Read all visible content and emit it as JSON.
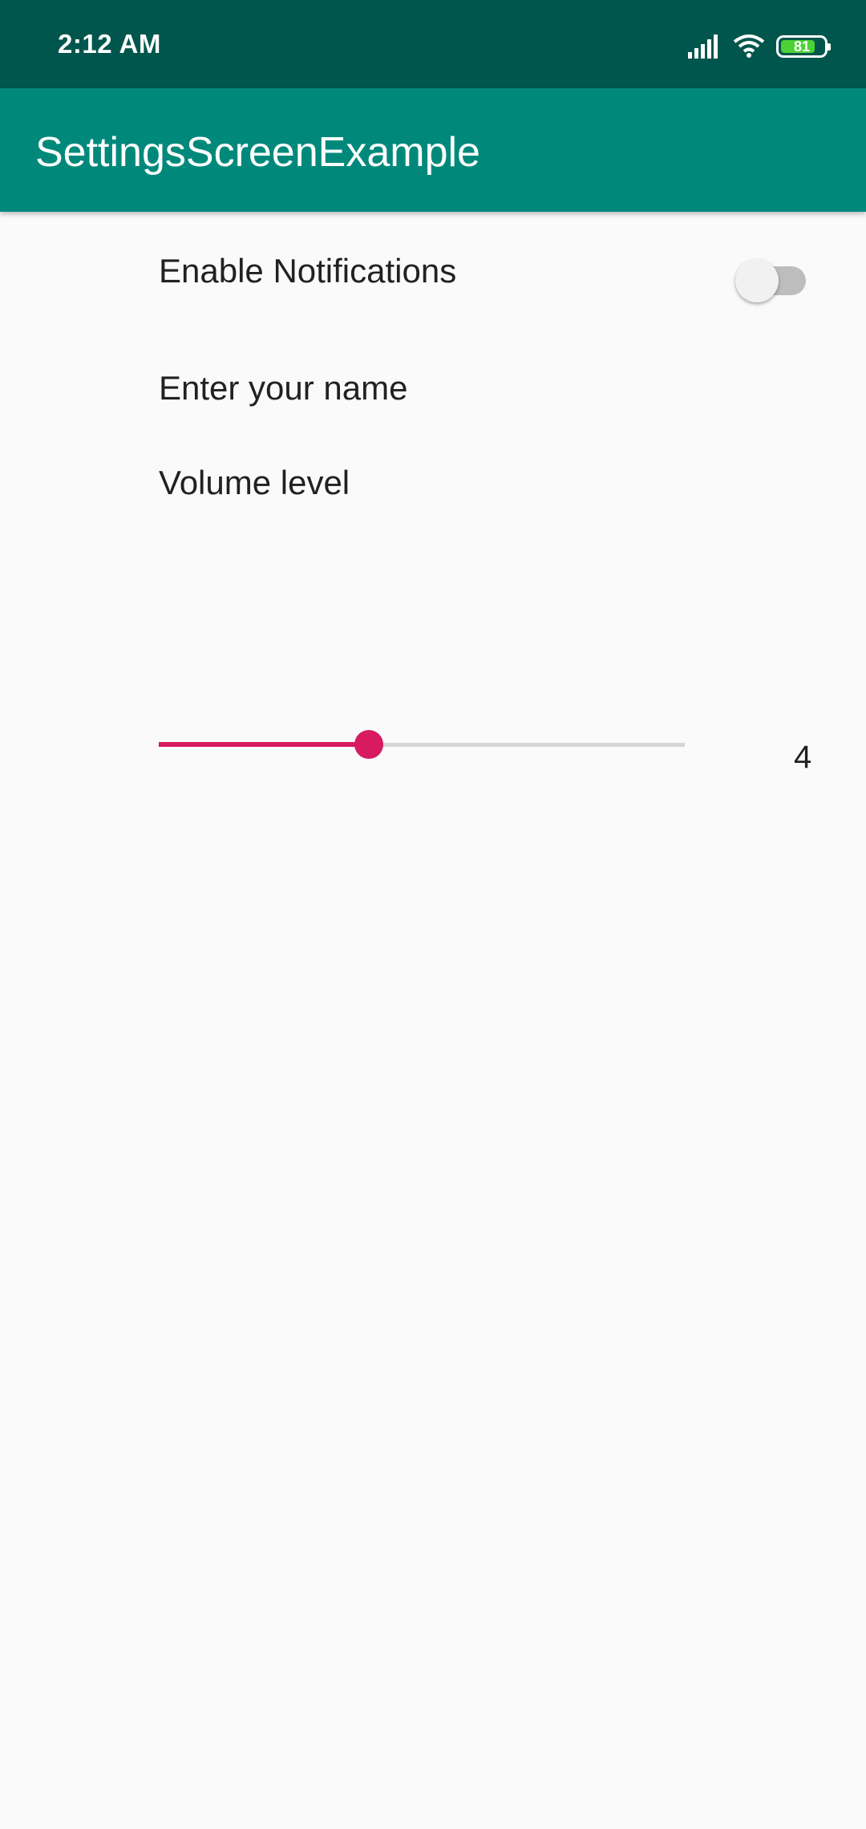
{
  "status_bar": {
    "time": "2:12 AM",
    "battery_level": "81",
    "icons": [
      "signal-icon",
      "wifi-icon",
      "battery-icon"
    ],
    "background": "#00564c"
  },
  "app_bar": {
    "title": "SettingsScreenExample",
    "background": "#00897b"
  },
  "preferences": {
    "notifications": {
      "title": "Enable Notifications",
      "checked": false
    },
    "name": {
      "title": "Enter your name"
    },
    "volume": {
      "title": "Volume level",
      "value": "4",
      "fraction": 0.4,
      "accent": "#d81b60"
    }
  }
}
